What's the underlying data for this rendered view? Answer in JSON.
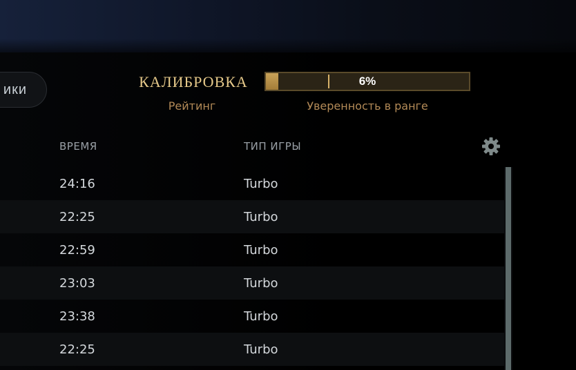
{
  "header": {
    "partial_button_label": "ики"
  },
  "rank": {
    "title": "КАЛИБРОВКА",
    "subtitle": "Рейтинг",
    "confidence_label": "6%",
    "confidence_value": 0.06,
    "confidence_caption": "Уверенность в ранге"
  },
  "table": {
    "columns": {
      "time": "ВРЕМЯ",
      "game_type": "ТИП ИГРЫ"
    },
    "rows": [
      {
        "time": "24:16",
        "game_type": "Turbo"
      },
      {
        "time": "22:25",
        "game_type": "Turbo"
      },
      {
        "time": "22:59",
        "game_type": "Turbo"
      },
      {
        "time": "23:03",
        "game_type": "Turbo"
      },
      {
        "time": "23:38",
        "game_type": "Turbo"
      },
      {
        "time": "22:25",
        "game_type": "Turbo"
      }
    ]
  },
  "icons": {
    "settings": "gear-icon"
  },
  "colors": {
    "accent_gold": "#e6c98a",
    "caption_gold": "#b38a57",
    "bar_fill": "#c9a259",
    "text_primary": "#d4d8dc",
    "header_text": "#9aa0a6"
  }
}
